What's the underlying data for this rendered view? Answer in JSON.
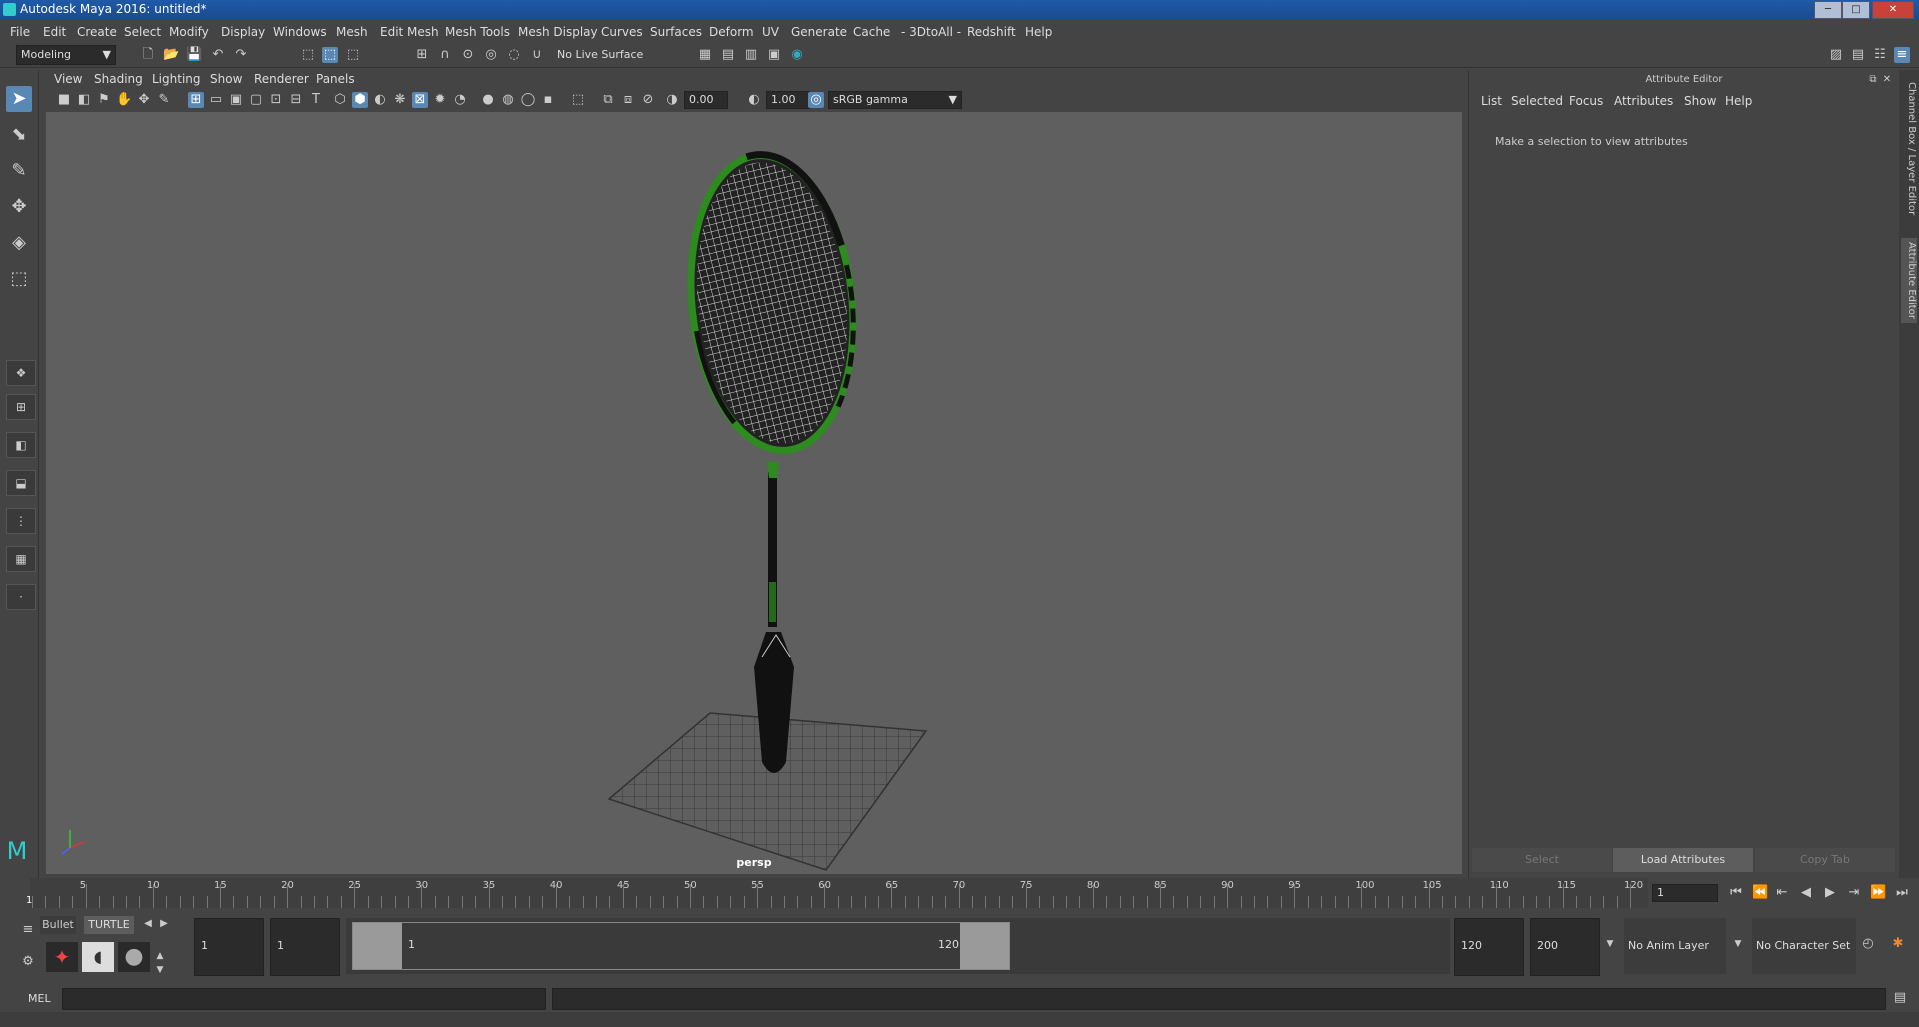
{
  "title_bar": {
    "text": "Autodesk Maya 2016: untitled*",
    "minimize": "─",
    "maximize": "□",
    "close": "✕"
  },
  "menubar": [
    "File",
    "Edit",
    "Create",
    "Select",
    "Modify",
    "Display",
    "Windows",
    "Mesh",
    "Edit Mesh",
    "Mesh Tools",
    "Mesh Display",
    "Curves",
    "Surfaces",
    "Deform",
    "UV",
    "Generate",
    "Cache",
    "- 3DtoAll -",
    "Redshift",
    "Help"
  ],
  "status_line": {
    "mode": "Modeling",
    "live_surface": "No Live Surface"
  },
  "panel_menu": [
    "View",
    "Shading",
    "Lighting",
    "Show",
    "Renderer",
    "Panels"
  ],
  "panel_toolbar": {
    "exposure": "0.00",
    "gamma": "1.00",
    "color_space": "sRGB gamma"
  },
  "viewport": {
    "camera_label": "persp"
  },
  "attribute_editor": {
    "title": "Attribute Editor",
    "menu": [
      "List",
      "Selected",
      "Focus",
      "Attributes",
      "Show",
      "Help"
    ],
    "message": "Make a selection to view attributes",
    "buttons": {
      "select": "Select",
      "load": "Load Attributes",
      "copy": "Copy Tab"
    }
  },
  "side_tabs": {
    "channel_box": "Channel Box / Layer Editor",
    "attr_editor": "Attribute Editor"
  },
  "time_slider": {
    "ticks": [
      "5",
      "10",
      "15",
      "20",
      "25",
      "30",
      "35",
      "40",
      "45",
      "50",
      "55",
      "60",
      "65",
      "70",
      "75",
      "80",
      "85",
      "90",
      "95",
      "100",
      "105",
      "110",
      "115",
      "120"
    ],
    "start_mark": "1",
    "current_frame": "1"
  },
  "range_slider": {
    "shelf_tabs": [
      "Bullet",
      "TURTLE"
    ],
    "start_time": "1",
    "playback_start": "1",
    "range_start_label": "1",
    "range_end_label": "120",
    "playback_end": "120",
    "end_time": "200",
    "anim_layer": "No Anim Layer",
    "character_set": "No Character Set"
  },
  "command_line": {
    "label": "MEL"
  },
  "colors": {
    "accent": "#5a88b5",
    "title_bar": "#1f5aa8",
    "racket_green": "#2e8b1f",
    "viewport_bg": "#5f5f5f"
  }
}
